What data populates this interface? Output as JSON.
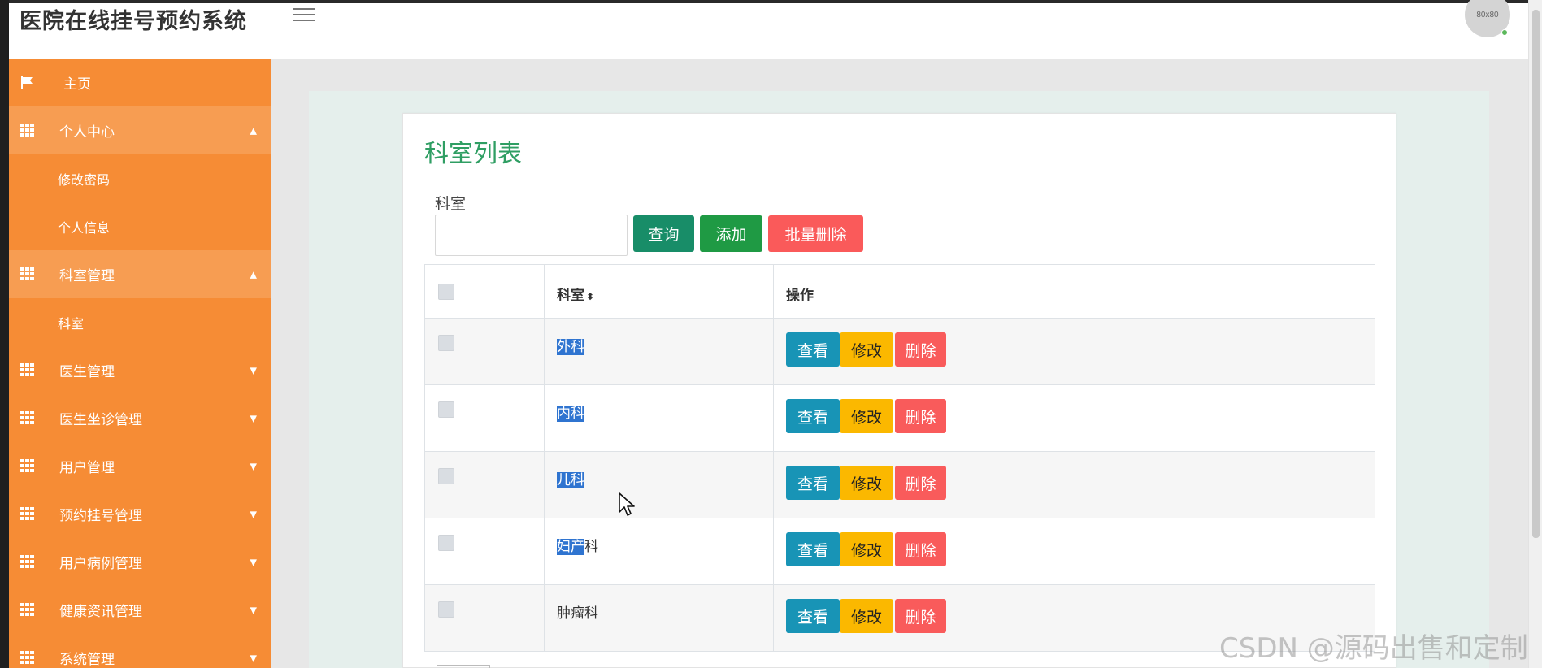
{
  "app": {
    "title": "医院在线挂号预约系统",
    "avatar_text": "80x80"
  },
  "sidebar": {
    "home": "主页",
    "personal_center": {
      "label": "个人中心",
      "items": [
        "修改密码",
        "个人信息"
      ]
    },
    "dept_mgmt": {
      "label": "科室管理",
      "items": [
        "科室"
      ]
    },
    "sections": [
      "医生管理",
      "医生坐诊管理",
      "用户管理",
      "预约挂号管理",
      "用户病例管理",
      "健康资讯管理",
      "系统管理"
    ]
  },
  "panel": {
    "title": "科室列表",
    "filter_label": "科室",
    "buttons": {
      "query": "查询",
      "add": "添加",
      "batch_delete": "批量删除"
    }
  },
  "table": {
    "headers": {
      "name": "科室",
      "sort": "⬍",
      "ops": "操作"
    },
    "rows": [
      {
        "name": "外科",
        "selected": "外科",
        "rest": ""
      },
      {
        "name": "内科",
        "selected": "内科",
        "rest": ""
      },
      {
        "name": "儿科",
        "selected": "儿科",
        "rest": ""
      },
      {
        "name": "妇产科",
        "selected": "妇产",
        "rest": "科"
      },
      {
        "name": "肿瘤科",
        "selected": "",
        "rest": "肿瘤科"
      }
    ],
    "op_labels": {
      "view": "查看",
      "edit": "修改",
      "delete": "删除"
    }
  },
  "watermark": "CSDN @源码出售和定制",
  "colors": {
    "sidebar": "#f68c35",
    "title": "#2f9e63",
    "view": "#1894b6",
    "edit": "#fbb800",
    "delete": "#f95b5b"
  }
}
